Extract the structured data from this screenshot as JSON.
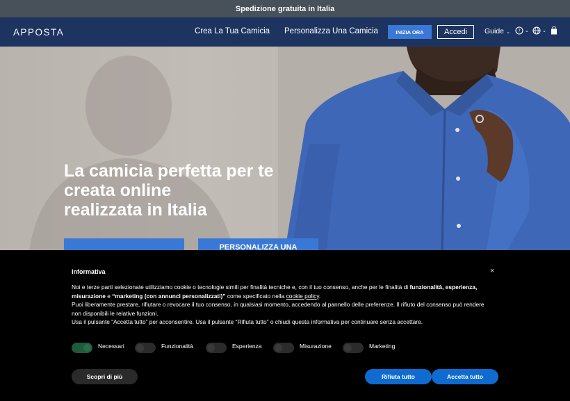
{
  "promo": {
    "text": "Spedizione gratuita in Italia"
  },
  "nav": {
    "logo": "APPOSTA",
    "links": [
      "Crea La Tua Camicia",
      "Personalizza Una Camicia"
    ],
    "start_label": "INIZIA ORA",
    "login_label": "Accedi",
    "guide_label": "Guide",
    "help_icon": "help-circle-icon",
    "language_icon": "globe-icon",
    "cart_icon": "shopping-bag-icon"
  },
  "hero": {
    "title_lines": [
      "La camicia perfetta per te",
      "creata online",
      "realizzata in Italia"
    ],
    "buttons": [
      "",
      "PERSONALIZZA UNA"
    ]
  },
  "cookie_banner": {
    "title": "Informativa",
    "close_label": "×",
    "p1_a": "Noi e terze parti selezionate utilizziamo cookie o tecnologie simili per finalità tecniche e, con il tuo consenso, anche per le finalità di ",
    "p1_b": "funzionalità, esperienza, misurazione",
    "p1_c": " e ",
    "p1_d": "“marketing (con annunci personalizzati)”",
    "p1_e": " come specificato nella ",
    "p1_link": "cookie policy",
    "p1_f": ".",
    "p2": "Puoi liberamente prestare, rifiutare o revocare il tuo consenso, in qualsiasi momento, accedendo al pannello delle preferenze. Il rifiuto del consenso può rendere non disponibili le relative funzioni.",
    "p3": "Usa il pulsante “Accetta tutto” per acconsentire. Usa il pulsante “Rifiuta tutto” o chiudi questa informativa per continuare senza accettare.",
    "toggles": [
      {
        "label": "Necessari",
        "on": true
      },
      {
        "label": "Funzionalità",
        "on": false
      },
      {
        "label": "Esperienza",
        "on": false
      },
      {
        "label": "Misurazione",
        "on": false
      },
      {
        "label": "Marketing",
        "on": false
      }
    ],
    "more_label": "Scopri di più",
    "reject_label": "Rifiuta tutto",
    "accept_label": "Accetta tutto"
  },
  "colors": {
    "nav_bg": "#1d3461",
    "accent": "#3a78d6",
    "cookie_button": "#0f6bcf"
  }
}
